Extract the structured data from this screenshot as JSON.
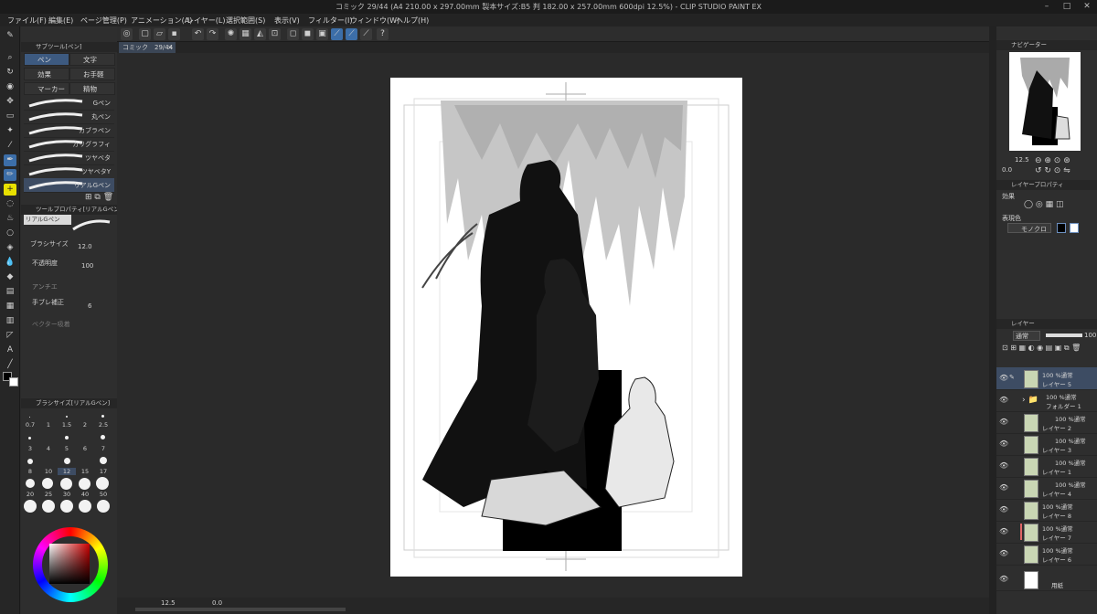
{
  "window": {
    "title": "コミック 29/44 (A4 210.00 x 297.00mm 製本サイズ:B5 判 182.00 x 257.00mm 600dpi 12.5%) - CLIP STUDIO PAINT EX"
  },
  "menu": [
    "ファイル(F)",
    "編集(E)",
    "ページ管理(P)",
    "アニメーション(A)",
    "レイヤー(L)",
    "選択範囲(S)",
    "表示(V)",
    "フィルター(I)",
    "ウィンドウ(W)",
    "ヘルプ(H)"
  ],
  "doc_tab": {
    "label": "コミック　29/44",
    "close": "×"
  },
  "subtool_panel": {
    "title": "サブツール[ペン]",
    "tabs": [
      "ペン",
      "文字",
      "効果",
      "お手軽",
      "マーカー",
      "精物"
    ],
    "brushes": [
      "Gペン",
      "丸ペン",
      "カブラペン",
      "カリグラフィ",
      "ツヤベタ",
      "ツヤベタY",
      "リアルGペン"
    ]
  },
  "tool_property": {
    "title": "ツールプロパティ[リアルGペン]",
    "brush_name": "リアルGペン",
    "brush_size_label": "ブラシサイズ",
    "brush_size_value": "12.0",
    "opacity_label": "不透明度",
    "opacity_value": "100",
    "antialias_label": "アンチエ",
    "stabilization_label": "手ブレ補正",
    "stabilization_value": "6",
    "vector_label": "ベクター吸着"
  },
  "brush_size_panel": {
    "title": "ブラシサイズ[リアルGペン]",
    "sizes": [
      "0.7",
      "1",
      "1.5",
      "2",
      "2.5",
      "3",
      "4",
      "5",
      "6",
      "7",
      "8",
      "10",
      "12",
      "15",
      "17",
      "20",
      "25",
      "30",
      "40",
      "50"
    ]
  },
  "navigator": {
    "title": "ナビゲーター",
    "zoom": "12.5",
    "angle": "0.0"
  },
  "layer_property": {
    "title": "レイヤープロパティ",
    "effect_label": "効果",
    "expression_label": "表現色",
    "expression_value": "モノクロ"
  },
  "layers_panel": {
    "title": "レイヤー",
    "blend": "通常",
    "opacity": "100",
    "layers": [
      {
        "line1": "100 %通常",
        "line2": "レイヤー 5"
      },
      {
        "line1": "100 %通常",
        "line2": "フォルダー 1"
      },
      {
        "line1": "100 %通常",
        "line2": "レイヤー 2"
      },
      {
        "line1": "100 %通常",
        "line2": "レイヤー 3"
      },
      {
        "line1": "100 %通常",
        "line2": "レイヤー 1"
      },
      {
        "line1": "100 %通常",
        "line2": "レイヤー 4"
      },
      {
        "line1": "100 %通常",
        "line2": "レイヤー 8"
      },
      {
        "line1": "100 %通常",
        "line2": "レイヤー 7"
      },
      {
        "line1": "100 %通常",
        "line2": "レイヤー 6"
      },
      {
        "line1": "",
        "line2": "用紙"
      }
    ]
  },
  "status": {
    "zoom": "12.5",
    "angle": "0.0"
  },
  "colors": {
    "accent": "#3c6ea8",
    "selected_row": "#3d4c63",
    "panel_bg": "#2e2e2e"
  }
}
